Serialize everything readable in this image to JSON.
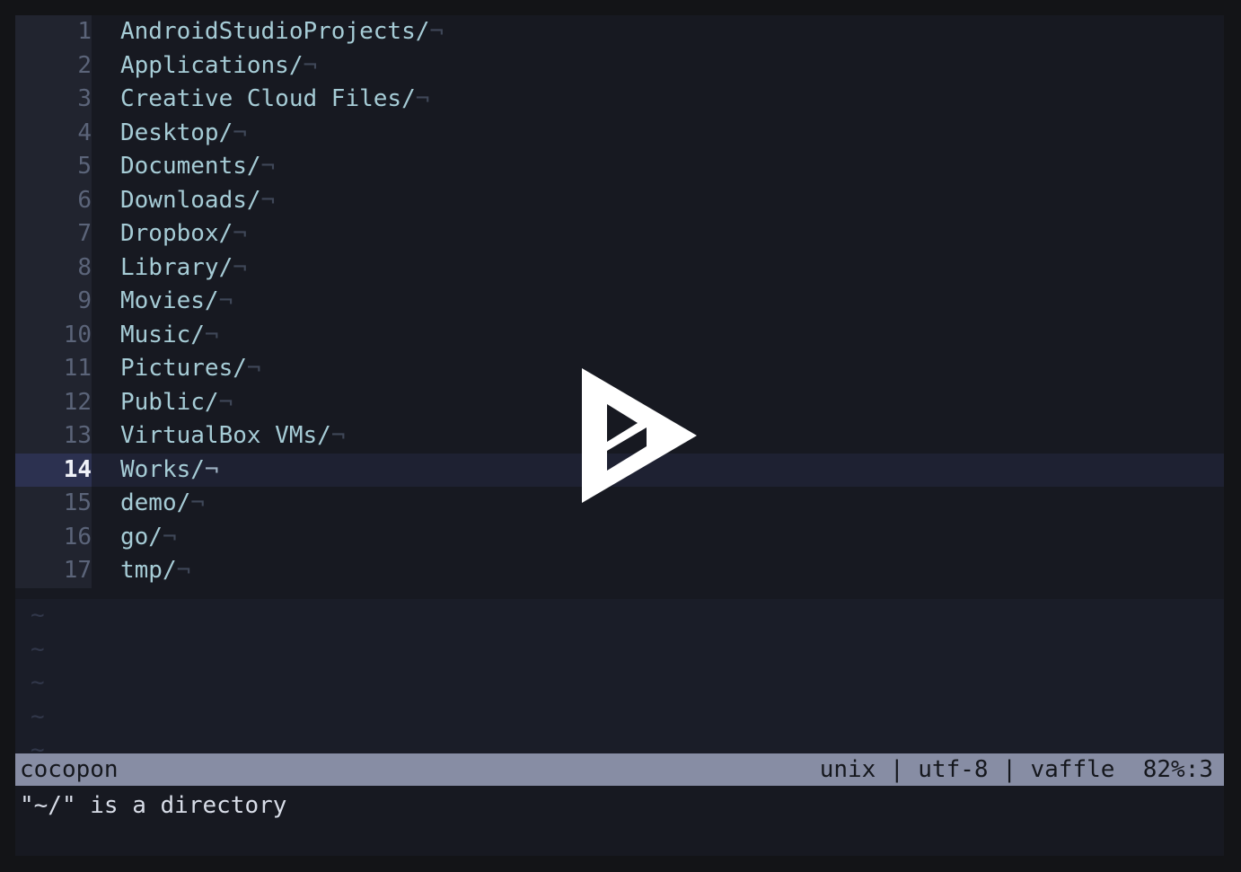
{
  "terminal": {
    "buffer_lines": [
      {
        "number": "1",
        "text": "AndroidStudioProjects/",
        "eol": "¬",
        "current": false
      },
      {
        "number": "2",
        "text": "Applications/",
        "eol": "¬",
        "current": false
      },
      {
        "number": "3",
        "text": "Creative Cloud Files/",
        "eol": "¬",
        "current": false
      },
      {
        "number": "4",
        "text": "Desktop/",
        "eol": "¬",
        "current": false
      },
      {
        "number": "5",
        "text": "Documents/",
        "eol": "¬",
        "current": false
      },
      {
        "number": "6",
        "text": "Downloads/",
        "eol": "¬",
        "current": false
      },
      {
        "number": "7",
        "text": "Dropbox/",
        "eol": "¬",
        "current": false
      },
      {
        "number": "8",
        "text": "Library/",
        "eol": "¬",
        "current": false
      },
      {
        "number": "9",
        "text": "Movies/",
        "eol": "¬",
        "current": false
      },
      {
        "number": "10",
        "text": "Music/",
        "eol": "¬",
        "current": false
      },
      {
        "number": "11",
        "text": "Pictures/",
        "eol": "¬",
        "current": false
      },
      {
        "number": "12",
        "text": "Public/",
        "eol": "¬",
        "current": false
      },
      {
        "number": "13",
        "text": "VirtualBox VMs/",
        "eol": "¬",
        "current": false
      },
      {
        "number": "14",
        "text": "Works/",
        "eol": "¬",
        "current": true
      },
      {
        "number": "15",
        "text": "demo/",
        "eol": "¬",
        "current": false
      },
      {
        "number": "16",
        "text": "go/",
        "eol": "¬",
        "current": false
      },
      {
        "number": "17",
        "text": "tmp/",
        "eol": "¬",
        "current": false
      }
    ],
    "filler_marker": "~",
    "filler_count": 5,
    "statusline": {
      "left": "cocopon",
      "right": "unix | utf-8 | vaffle  82%:3",
      "fileformat": "unix",
      "encoding": "utf-8",
      "filetype": "vaffle",
      "position": "82%:3",
      "background_color": "#878da4",
      "text_color": "#15171d"
    },
    "message": "\"~/\" is a directory"
  },
  "player": {
    "play_icon": "asciinema-play-icon",
    "icon_color": "#ffffff"
  },
  "colors": {
    "frame": "#131417",
    "screen_bg": "#171921",
    "gutter_bg": "#21242f",
    "gutter_fg": "#5b6479",
    "text_fg": "#a6ccd6",
    "eol_fg": "#3f4758",
    "cursorline_bg": "#1e2132",
    "cursorline_gutter_bg": "#2c3150",
    "cursorline_gutter_fg": "#f0f2f8",
    "message_fg": "#d8dde8"
  }
}
